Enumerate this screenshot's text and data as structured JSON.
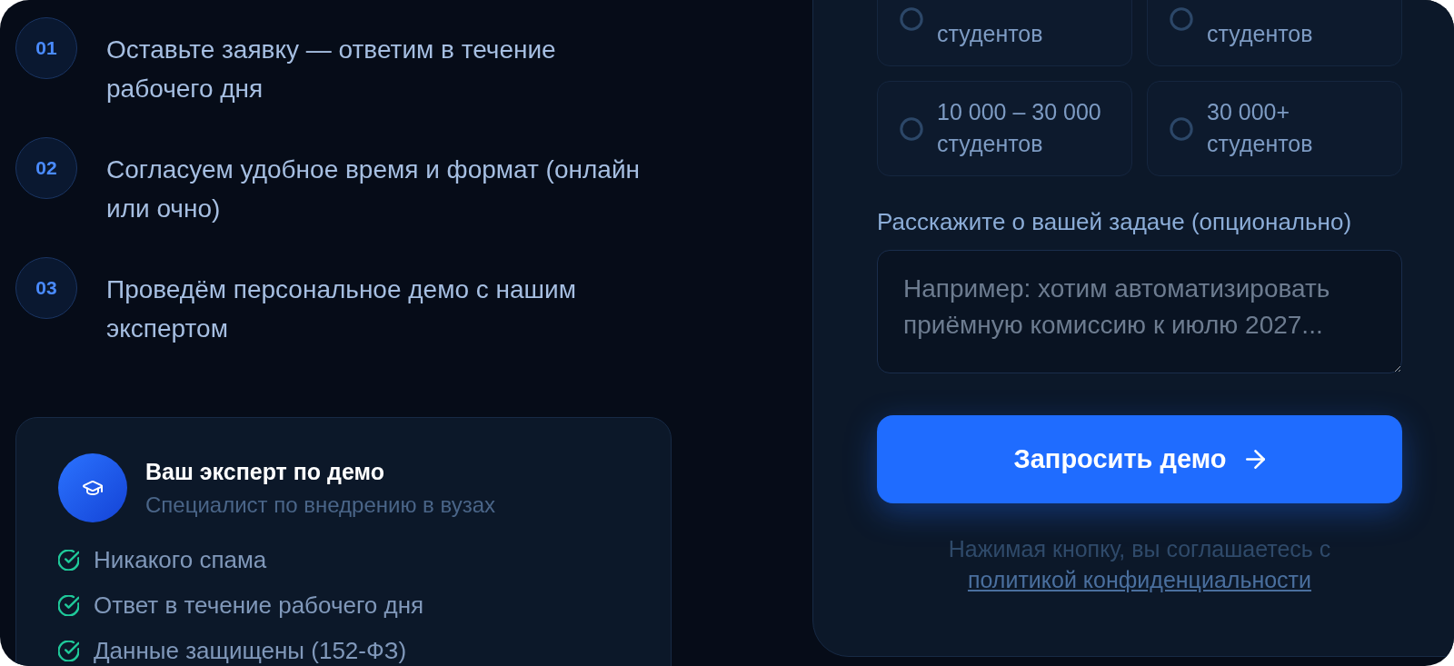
{
  "steps": [
    {
      "number": "01",
      "text": "Оставьте заявку — ответим в течение рабочего дня"
    },
    {
      "number": "02",
      "text": "Согласуем удобное время и формат (онлайн или очно)"
    },
    {
      "number": "03",
      "text": "Проведём персональное демо с нашим экспертом"
    }
  ],
  "expert_card": {
    "title": "Ваш эксперт по демо",
    "subtitle": "Специалист по внедрению в вузах",
    "benefits": [
      "Никакого спама",
      "Ответ в течение рабочего дня",
      "Данные защищены (152-ФЗ)"
    ]
  },
  "form": {
    "size_options": [
      {
        "unit": "студентов",
        "selected": false
      },
      {
        "unit": "студентов",
        "selected": false
      },
      {
        "range": "10 000 – 30 000",
        "unit": "студентов",
        "selected": false
      },
      {
        "range": "30 000+",
        "unit": "студентов",
        "selected": false
      }
    ],
    "task_field": {
      "label": "Расскажите о вашей задаче (опционально)",
      "placeholder": "Например: хотим автоматизировать приёмную комиссию к июлю 2027..."
    },
    "submit_button": "Запросить демо",
    "consent": {
      "text": "Нажимая кнопку, вы соглашаетесь с",
      "link": "политикой конфиденциальности"
    }
  }
}
